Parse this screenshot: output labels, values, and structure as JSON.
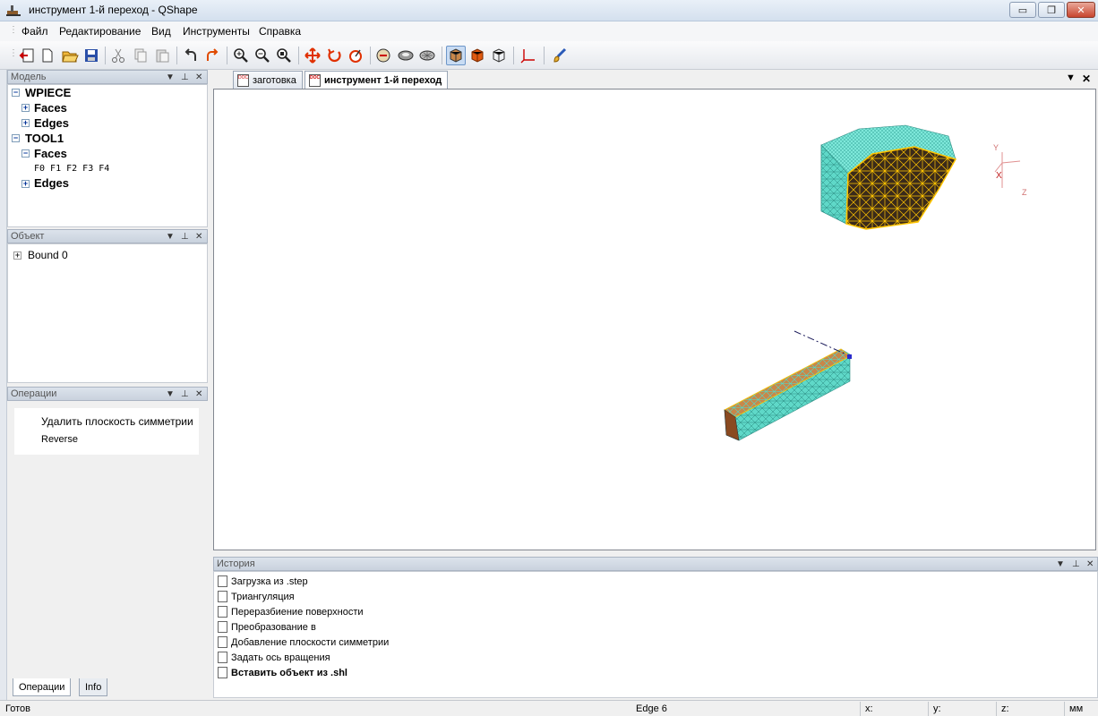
{
  "window": {
    "title": "инструмент 1-й переход - QShape",
    "controls": {
      "minimize": "▭",
      "maximize": "❐",
      "close": "✕"
    }
  },
  "menu": [
    "Файл",
    "Редактирование",
    "Вид",
    "Инструменты",
    "Справка"
  ],
  "toolbar": [
    "export-icon",
    "new-document-icon",
    "open-folder-icon",
    "save-icon",
    "cut-icon",
    "copy-icon",
    "paste-icon",
    "undo-icon",
    "redo-icon",
    "zoom-in-icon",
    "zoom-out-icon",
    "zoom-fit-icon",
    "move-icon",
    "rotate-icon",
    "reset-view-icon",
    "measure-icon",
    "shade-icon",
    "mesh-icon",
    "shaded-edges-icon",
    "solid-icon",
    "wireframe-icon",
    "axes-icon",
    "brush-icon"
  ],
  "model_panel": {
    "title": "Модель",
    "tree": {
      "wpiece": "WPIECE",
      "wpiece_faces": "Faces",
      "wpiece_edges": "Edges",
      "tool1": "TOOL1",
      "tool1_faces": "Faces",
      "faces_list": "F0 F1 F2 F3 F4",
      "tool1_edges": "Edges"
    }
  },
  "object_panel": {
    "title": "Объект",
    "item": "Bound 0"
  },
  "operations_panel": {
    "title": "Операции",
    "items": [
      "Удалить плоскость симметрии",
      "Reverse"
    ]
  },
  "left_tabs": [
    "Операции",
    "Info"
  ],
  "doc_tabs": [
    "заготовка",
    "инструмент 1-й переход"
  ],
  "doc_tab_icon_text": "DOC",
  "axes": {
    "y": "Y",
    "x": "X",
    "z": "Z"
  },
  "history_panel": {
    "title": "История",
    "items": [
      "Загрузка из .step",
      "Триангуляция",
      "Переразбиение поверхности",
      "Преобразование в",
      "Добавление плоскости симметрии",
      "Задать ось вращения",
      "Вставить объект из .shl"
    ]
  },
  "statusbar": {
    "status": "Готов",
    "selection": "Edge 6",
    "x_label": "x:",
    "y_label": "y:",
    "z_label": "z:",
    "unit": "мм"
  },
  "dock_controls": {
    "menu": "▼",
    "pin": "⊥",
    "close": "✕"
  },
  "colors": {
    "mesh_cyan": "#66e0d0",
    "mesh_orange": "#c8874a",
    "mesh_dark": "#3a2a1a",
    "edge_yellow": "#ffc400",
    "axis_red": "#d02020"
  }
}
